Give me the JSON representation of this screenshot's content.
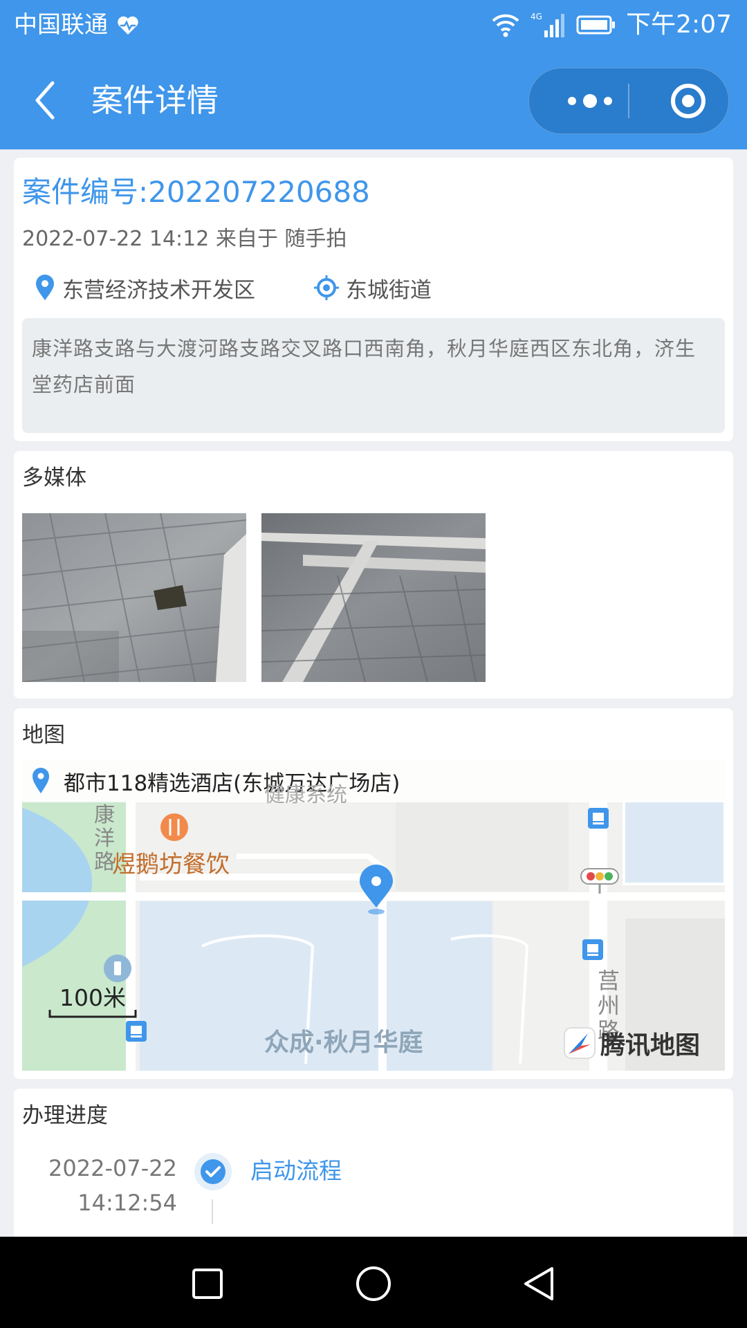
{
  "status_bar": {
    "carrier": "中国联通",
    "time": "下午2:07",
    "network": "4G",
    "icons": [
      "heart-pulse-icon",
      "wifi-icon",
      "signal-icon",
      "battery-icon"
    ]
  },
  "title_bar": {
    "title": "案件详情",
    "back_icon": "chevron-left-icon",
    "more_icon": "more-dots-icon",
    "close_icon": "target-close-icon"
  },
  "case": {
    "number": "案件编号:202207220688",
    "meta": "2022-07-22 14:12 来自于 随手拍",
    "district": "东营经济技术开发区",
    "street": "东城街道",
    "address": "康洋路支路与大渡河路支路交叉路口西南角，秋月华庭西区东北角，济生堂药店前面"
  },
  "media": {
    "title": "多媒体",
    "photos": [
      {
        "name": "pavement-photo-1"
      },
      {
        "name": "pavement-photo-2"
      }
    ]
  },
  "map": {
    "title": "地图",
    "location_label": "都市118精选酒店(东城万达广场店)",
    "labels": {
      "road_left": "康洋路",
      "restaurant": "煜鹅坊餐饮",
      "top_label": "健康系统",
      "community": "众成·秋月华庭",
      "road_right": "莒州路"
    },
    "scale": "100米",
    "provider": "腾讯地图"
  },
  "progress": {
    "title": "办理进度",
    "steps": [
      {
        "date": "2022-07-22",
        "time": "14:12:54",
        "label": "启动流程",
        "status": "done"
      }
    ]
  },
  "colors": {
    "primary": "#3f96ea",
    "background": "#eef0f3",
    "capsule": "#2a7ccd",
    "address_box": "#ebeef0"
  }
}
